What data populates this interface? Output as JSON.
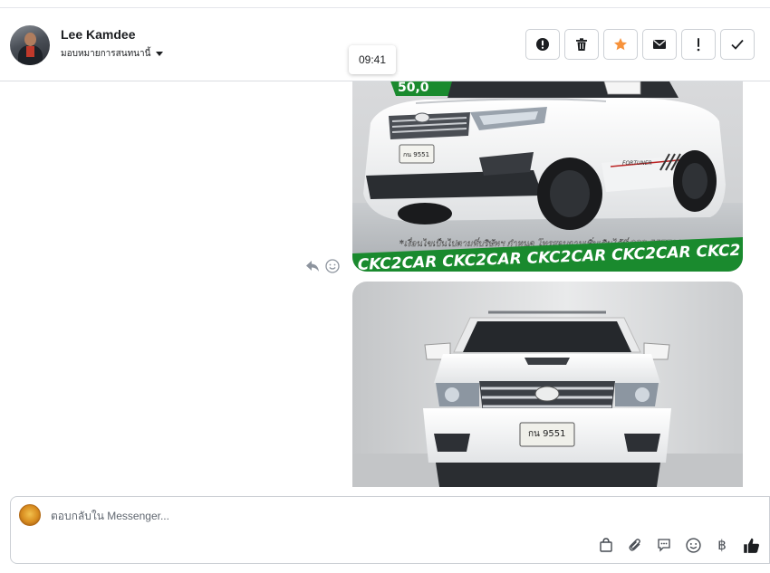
{
  "contact": {
    "name": "Lee Kamdee",
    "assign_label": "มอบหมายการสนทนานี้"
  },
  "toolbar": {
    "buttons": [
      {
        "name": "spam",
        "icon": "alert-circle-icon"
      },
      {
        "name": "delete",
        "icon": "trash-icon"
      },
      {
        "name": "star",
        "icon": "star-icon",
        "color": "#f7923b"
      },
      {
        "name": "mark-unread",
        "icon": "envelope-icon"
      },
      {
        "name": "follow-up",
        "icon": "exclamation-icon"
      },
      {
        "name": "done",
        "icon": "checkmark-icon"
      }
    ]
  },
  "tooltip": {
    "time": "09:41"
  },
  "messages": {
    "image1": {
      "promo_text": "*เงื่อนไขเป็นไปตามที่บริษัทฯ กำหนด โทรสอบถามเพิ่มเติมได้ที่ 088-5577932",
      "banner_text": "CKC2CAR CKC2CAR CKC2CAR CKC2CAR CKC2",
      "plate": "กน 9551",
      "model_decal": "FORTUNER"
    },
    "image2": {
      "plate": "กน 9551"
    }
  },
  "composer": {
    "placeholder": "ตอบกลับใน Messenger..."
  },
  "colors": {
    "accent_star": "#f7923b",
    "banner_green": "#1a8a2e",
    "icon_gray": "#444950"
  }
}
